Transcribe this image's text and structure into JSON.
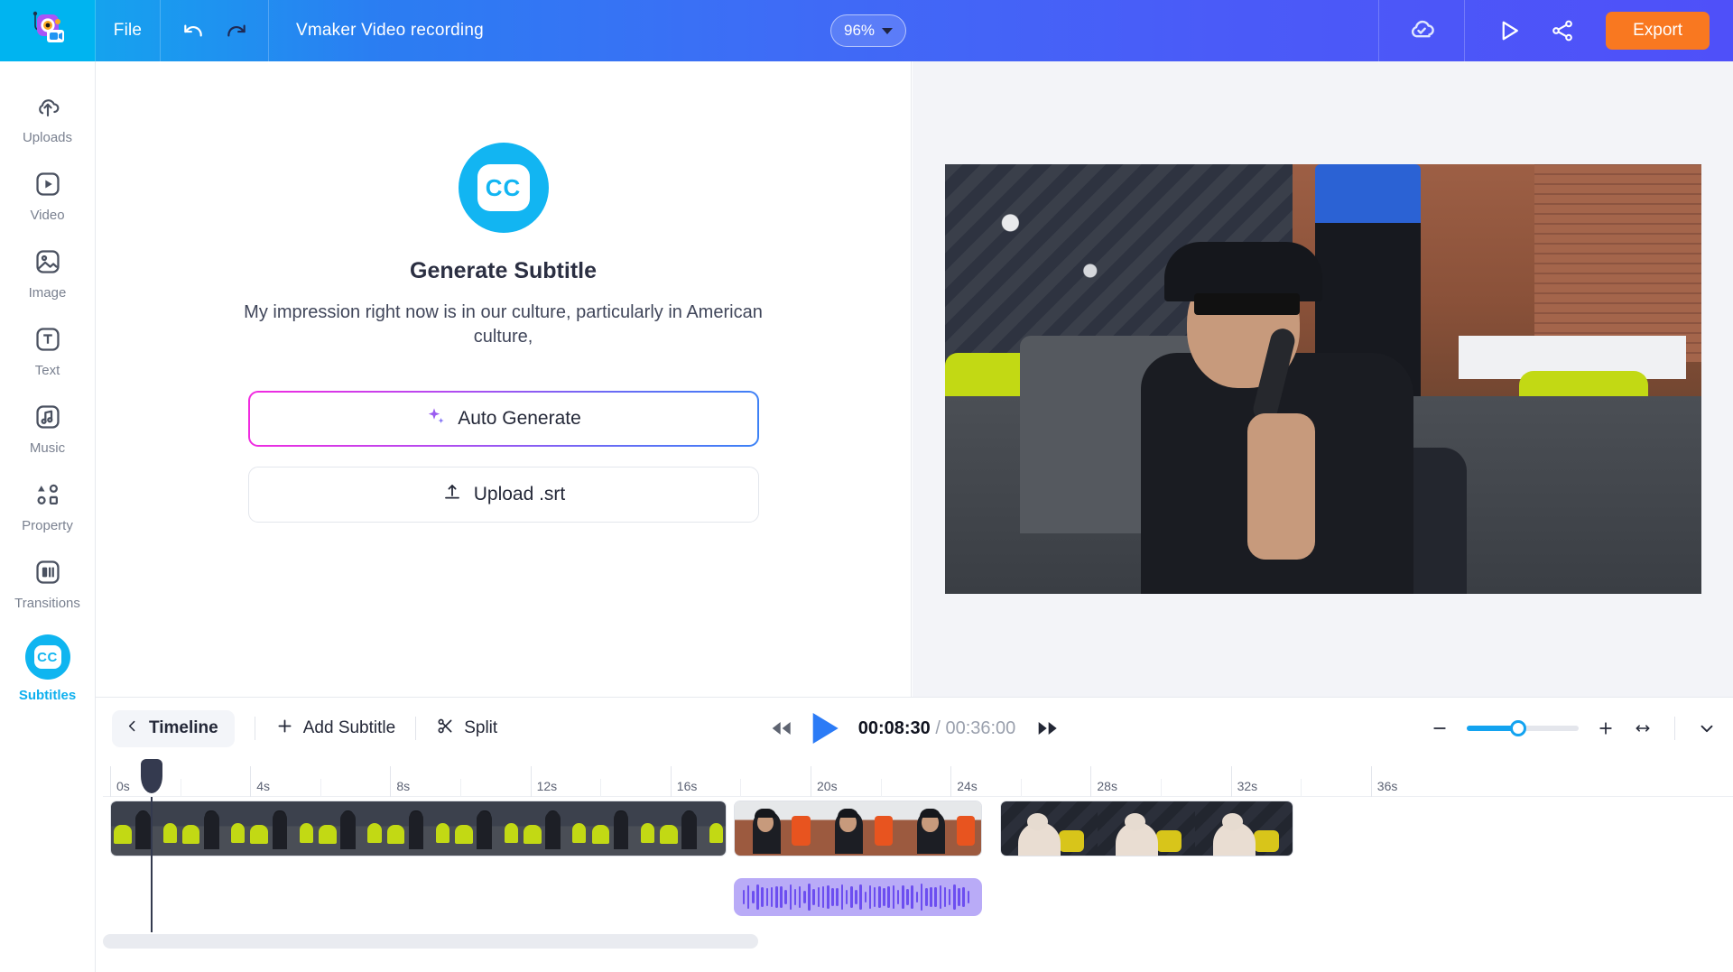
{
  "header": {
    "logo_name": "vmaker-logo",
    "file_menu": "File",
    "undo_icon": "undo-icon",
    "redo_icon": "redo-icon",
    "project_title": "Vmaker Video recording",
    "zoom_level": "96%",
    "cloud_icon": "cloud-saved-icon",
    "preview_icon": "preview-play-icon",
    "share_icon": "share-icon",
    "export_label": "Export"
  },
  "sidebar": {
    "items": [
      {
        "label": "Uploads",
        "icon": "upload-cloud-icon",
        "active": false
      },
      {
        "label": "Video",
        "icon": "video-icon",
        "active": false
      },
      {
        "label": "Image",
        "icon": "image-icon",
        "active": false
      },
      {
        "label": "Text",
        "icon": "text-icon",
        "active": false
      },
      {
        "label": "Music",
        "icon": "music-icon",
        "active": false
      },
      {
        "label": "Property",
        "icon": "property-icon",
        "active": false
      },
      {
        "label": "Transitions",
        "icon": "transitions-icon",
        "active": false
      },
      {
        "label": "Subtitles",
        "icon": "cc-icon",
        "active": true
      }
    ]
  },
  "editor": {
    "badge_icon": "cc-icon",
    "badge_text": "CC",
    "title": "Generate Subtitle",
    "description": "My impression right now is in our culture, particularly in American culture,",
    "auto_generate_label": "Auto Generate",
    "auto_generate_icon": "sparkle-icon",
    "upload_label": "Upload .srt",
    "upload_icon": "upload-arrow-icon"
  },
  "timeline": {
    "back_icon": "chevron-left-icon",
    "timeline_label": "Timeline",
    "add_subtitle_label": "Add Subtitle",
    "add_icon": "plus-icon",
    "split_label": "Split",
    "split_icon": "scissors-icon",
    "rewind_icon": "rewind-icon",
    "play_icon": "play-icon",
    "forward_icon": "fast-forward-icon",
    "current_time": "00:08:30",
    "separator": "/",
    "total_time": "00:36:00",
    "zoom_out_icon": "minus-icon",
    "zoom_in_icon": "plus-icon",
    "fit_icon": "fit-width-icon",
    "collapse_icon": "chevron-down-icon",
    "zoom_slider_percent": 46,
    "playhead_seconds": 1.15,
    "ruler": {
      "labels": [
        "0s",
        "4s",
        "8s",
        "12s",
        "16s",
        "20s",
        "24s",
        "28s",
        "32s",
        "36s"
      ],
      "seconds": [
        0,
        4,
        8,
        12,
        16,
        20,
        24,
        28,
        32,
        36
      ]
    },
    "video_clips": [
      {
        "name": "clip-1",
        "start": 0.0,
        "end": 17.6,
        "thumbs": 9,
        "style": "tA"
      },
      {
        "name": "clip-2",
        "start": 17.8,
        "end": 24.9,
        "thumbs": 3,
        "style": "tB"
      },
      {
        "name": "clip-3",
        "start": 25.4,
        "end": 33.8,
        "thumbs": 3,
        "style": "tC"
      }
    ],
    "audio_clips": [
      {
        "name": "audio-1",
        "start": 17.8,
        "end": 24.9
      }
    ]
  },
  "colors": {
    "brand_cyan": "#0fb5f0",
    "brand_blue": "#2b7bf6",
    "accent_orange": "#f97820",
    "audio_purple": "#b9abf7",
    "header_gradient_start": "#00b3f0",
    "header_gradient_end": "#4f50f9"
  }
}
